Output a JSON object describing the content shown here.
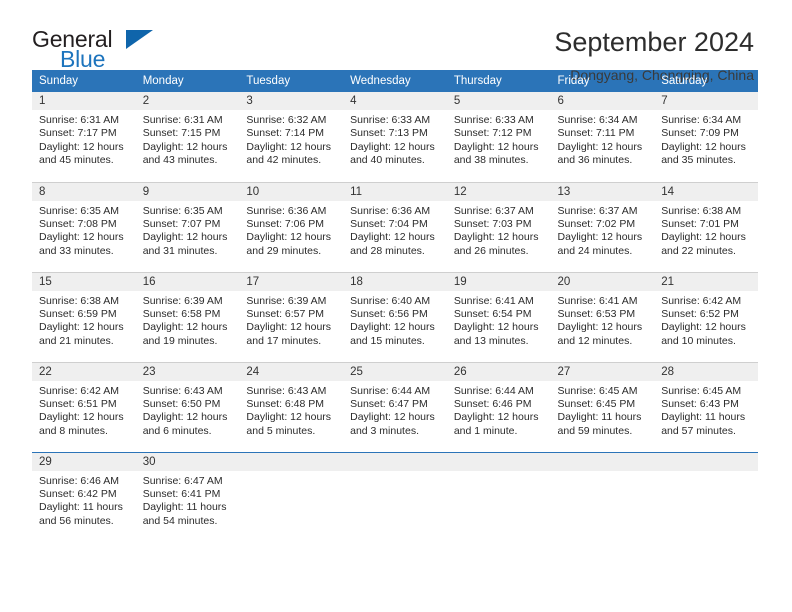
{
  "brand": {
    "word_one": "General",
    "word_two": "Blue",
    "triangle_icon": "triangle-logo-icon"
  },
  "header": {
    "month_title": "September 2024",
    "location": "Dongyang, Chongqing, China"
  },
  "colors": {
    "header_blue": "#2b74b8",
    "brand_blue": "#1d74bd",
    "daynum_band": "#efefef",
    "row_divider": "#cfcfcf"
  },
  "calendar": {
    "weekday_headers": [
      "Sunday",
      "Monday",
      "Tuesday",
      "Wednesday",
      "Thursday",
      "Friday",
      "Saturday"
    ],
    "labels": {
      "sunrise": "Sunrise:",
      "sunset": "Sunset:",
      "daylight": "Daylight:"
    },
    "weeks": [
      [
        {
          "day": "1",
          "sunrise": "Sunrise: 6:31 AM",
          "sunset": "Sunset: 7:17 PM",
          "daylight_1": "Daylight: 12 hours",
          "daylight_2": "and 45 minutes."
        },
        {
          "day": "2",
          "sunrise": "Sunrise: 6:31 AM",
          "sunset": "Sunset: 7:15 PM",
          "daylight_1": "Daylight: 12 hours",
          "daylight_2": "and 43 minutes."
        },
        {
          "day": "3",
          "sunrise": "Sunrise: 6:32 AM",
          "sunset": "Sunset: 7:14 PM",
          "daylight_1": "Daylight: 12 hours",
          "daylight_2": "and 42 minutes."
        },
        {
          "day": "4",
          "sunrise": "Sunrise: 6:33 AM",
          "sunset": "Sunset: 7:13 PM",
          "daylight_1": "Daylight: 12 hours",
          "daylight_2": "and 40 minutes."
        },
        {
          "day": "5",
          "sunrise": "Sunrise: 6:33 AM",
          "sunset": "Sunset: 7:12 PM",
          "daylight_1": "Daylight: 12 hours",
          "daylight_2": "and 38 minutes."
        },
        {
          "day": "6",
          "sunrise": "Sunrise: 6:34 AM",
          "sunset": "Sunset: 7:11 PM",
          "daylight_1": "Daylight: 12 hours",
          "daylight_2": "and 36 minutes."
        },
        {
          "day": "7",
          "sunrise": "Sunrise: 6:34 AM",
          "sunset": "Sunset: 7:09 PM",
          "daylight_1": "Daylight: 12 hours",
          "daylight_2": "and 35 minutes."
        }
      ],
      [
        {
          "day": "8",
          "sunrise": "Sunrise: 6:35 AM",
          "sunset": "Sunset: 7:08 PM",
          "daylight_1": "Daylight: 12 hours",
          "daylight_2": "and 33 minutes."
        },
        {
          "day": "9",
          "sunrise": "Sunrise: 6:35 AM",
          "sunset": "Sunset: 7:07 PM",
          "daylight_1": "Daylight: 12 hours",
          "daylight_2": "and 31 minutes."
        },
        {
          "day": "10",
          "sunrise": "Sunrise: 6:36 AM",
          "sunset": "Sunset: 7:06 PM",
          "daylight_1": "Daylight: 12 hours",
          "daylight_2": "and 29 minutes."
        },
        {
          "day": "11",
          "sunrise": "Sunrise: 6:36 AM",
          "sunset": "Sunset: 7:04 PM",
          "daylight_1": "Daylight: 12 hours",
          "daylight_2": "and 28 minutes."
        },
        {
          "day": "12",
          "sunrise": "Sunrise: 6:37 AM",
          "sunset": "Sunset: 7:03 PM",
          "daylight_1": "Daylight: 12 hours",
          "daylight_2": "and 26 minutes."
        },
        {
          "day": "13",
          "sunrise": "Sunrise: 6:37 AM",
          "sunset": "Sunset: 7:02 PM",
          "daylight_1": "Daylight: 12 hours",
          "daylight_2": "and 24 minutes."
        },
        {
          "day": "14",
          "sunrise": "Sunrise: 6:38 AM",
          "sunset": "Sunset: 7:01 PM",
          "daylight_1": "Daylight: 12 hours",
          "daylight_2": "and 22 minutes."
        }
      ],
      [
        {
          "day": "15",
          "sunrise": "Sunrise: 6:38 AM",
          "sunset": "Sunset: 6:59 PM",
          "daylight_1": "Daylight: 12 hours",
          "daylight_2": "and 21 minutes."
        },
        {
          "day": "16",
          "sunrise": "Sunrise: 6:39 AM",
          "sunset": "Sunset: 6:58 PM",
          "daylight_1": "Daylight: 12 hours",
          "daylight_2": "and 19 minutes."
        },
        {
          "day": "17",
          "sunrise": "Sunrise: 6:39 AM",
          "sunset": "Sunset: 6:57 PM",
          "daylight_1": "Daylight: 12 hours",
          "daylight_2": "and 17 minutes."
        },
        {
          "day": "18",
          "sunrise": "Sunrise: 6:40 AM",
          "sunset": "Sunset: 6:56 PM",
          "daylight_1": "Daylight: 12 hours",
          "daylight_2": "and 15 minutes."
        },
        {
          "day": "19",
          "sunrise": "Sunrise: 6:41 AM",
          "sunset": "Sunset: 6:54 PM",
          "daylight_1": "Daylight: 12 hours",
          "daylight_2": "and 13 minutes."
        },
        {
          "day": "20",
          "sunrise": "Sunrise: 6:41 AM",
          "sunset": "Sunset: 6:53 PM",
          "daylight_1": "Daylight: 12 hours",
          "daylight_2": "and 12 minutes."
        },
        {
          "day": "21",
          "sunrise": "Sunrise: 6:42 AM",
          "sunset": "Sunset: 6:52 PM",
          "daylight_1": "Daylight: 12 hours",
          "daylight_2": "and 10 minutes."
        }
      ],
      [
        {
          "day": "22",
          "sunrise": "Sunrise: 6:42 AM",
          "sunset": "Sunset: 6:51 PM",
          "daylight_1": "Daylight: 12 hours",
          "daylight_2": "and 8 minutes."
        },
        {
          "day": "23",
          "sunrise": "Sunrise: 6:43 AM",
          "sunset": "Sunset: 6:50 PM",
          "daylight_1": "Daylight: 12 hours",
          "daylight_2": "and 6 minutes."
        },
        {
          "day": "24",
          "sunrise": "Sunrise: 6:43 AM",
          "sunset": "Sunset: 6:48 PM",
          "daylight_1": "Daylight: 12 hours",
          "daylight_2": "and 5 minutes."
        },
        {
          "day": "25",
          "sunrise": "Sunrise: 6:44 AM",
          "sunset": "Sunset: 6:47 PM",
          "daylight_1": "Daylight: 12 hours",
          "daylight_2": "and 3 minutes."
        },
        {
          "day": "26",
          "sunrise": "Sunrise: 6:44 AM",
          "sunset": "Sunset: 6:46 PM",
          "daylight_1": "Daylight: 12 hours",
          "daylight_2": "and 1 minute."
        },
        {
          "day": "27",
          "sunrise": "Sunrise: 6:45 AM",
          "sunset": "Sunset: 6:45 PM",
          "daylight_1": "Daylight: 11 hours",
          "daylight_2": "and 59 minutes."
        },
        {
          "day": "28",
          "sunrise": "Sunrise: 6:45 AM",
          "sunset": "Sunset: 6:43 PM",
          "daylight_1": "Daylight: 11 hours",
          "daylight_2": "and 57 minutes."
        }
      ],
      [
        {
          "day": "29",
          "sunrise": "Sunrise: 6:46 AM",
          "sunset": "Sunset: 6:42 PM",
          "daylight_1": "Daylight: 11 hours",
          "daylight_2": "and 56 minutes."
        },
        {
          "day": "30",
          "sunrise": "Sunrise: 6:47 AM",
          "sunset": "Sunset: 6:41 PM",
          "daylight_1": "Daylight: 11 hours",
          "daylight_2": "and 54 minutes."
        },
        {
          "day": "",
          "sunrise": "",
          "sunset": "",
          "daylight_1": "",
          "daylight_2": ""
        },
        {
          "day": "",
          "sunrise": "",
          "sunset": "",
          "daylight_1": "",
          "daylight_2": ""
        },
        {
          "day": "",
          "sunrise": "",
          "sunset": "",
          "daylight_1": "",
          "daylight_2": ""
        },
        {
          "day": "",
          "sunrise": "",
          "sunset": "",
          "daylight_1": "",
          "daylight_2": ""
        },
        {
          "day": "",
          "sunrise": "",
          "sunset": "",
          "daylight_1": "",
          "daylight_2": ""
        }
      ]
    ]
  }
}
